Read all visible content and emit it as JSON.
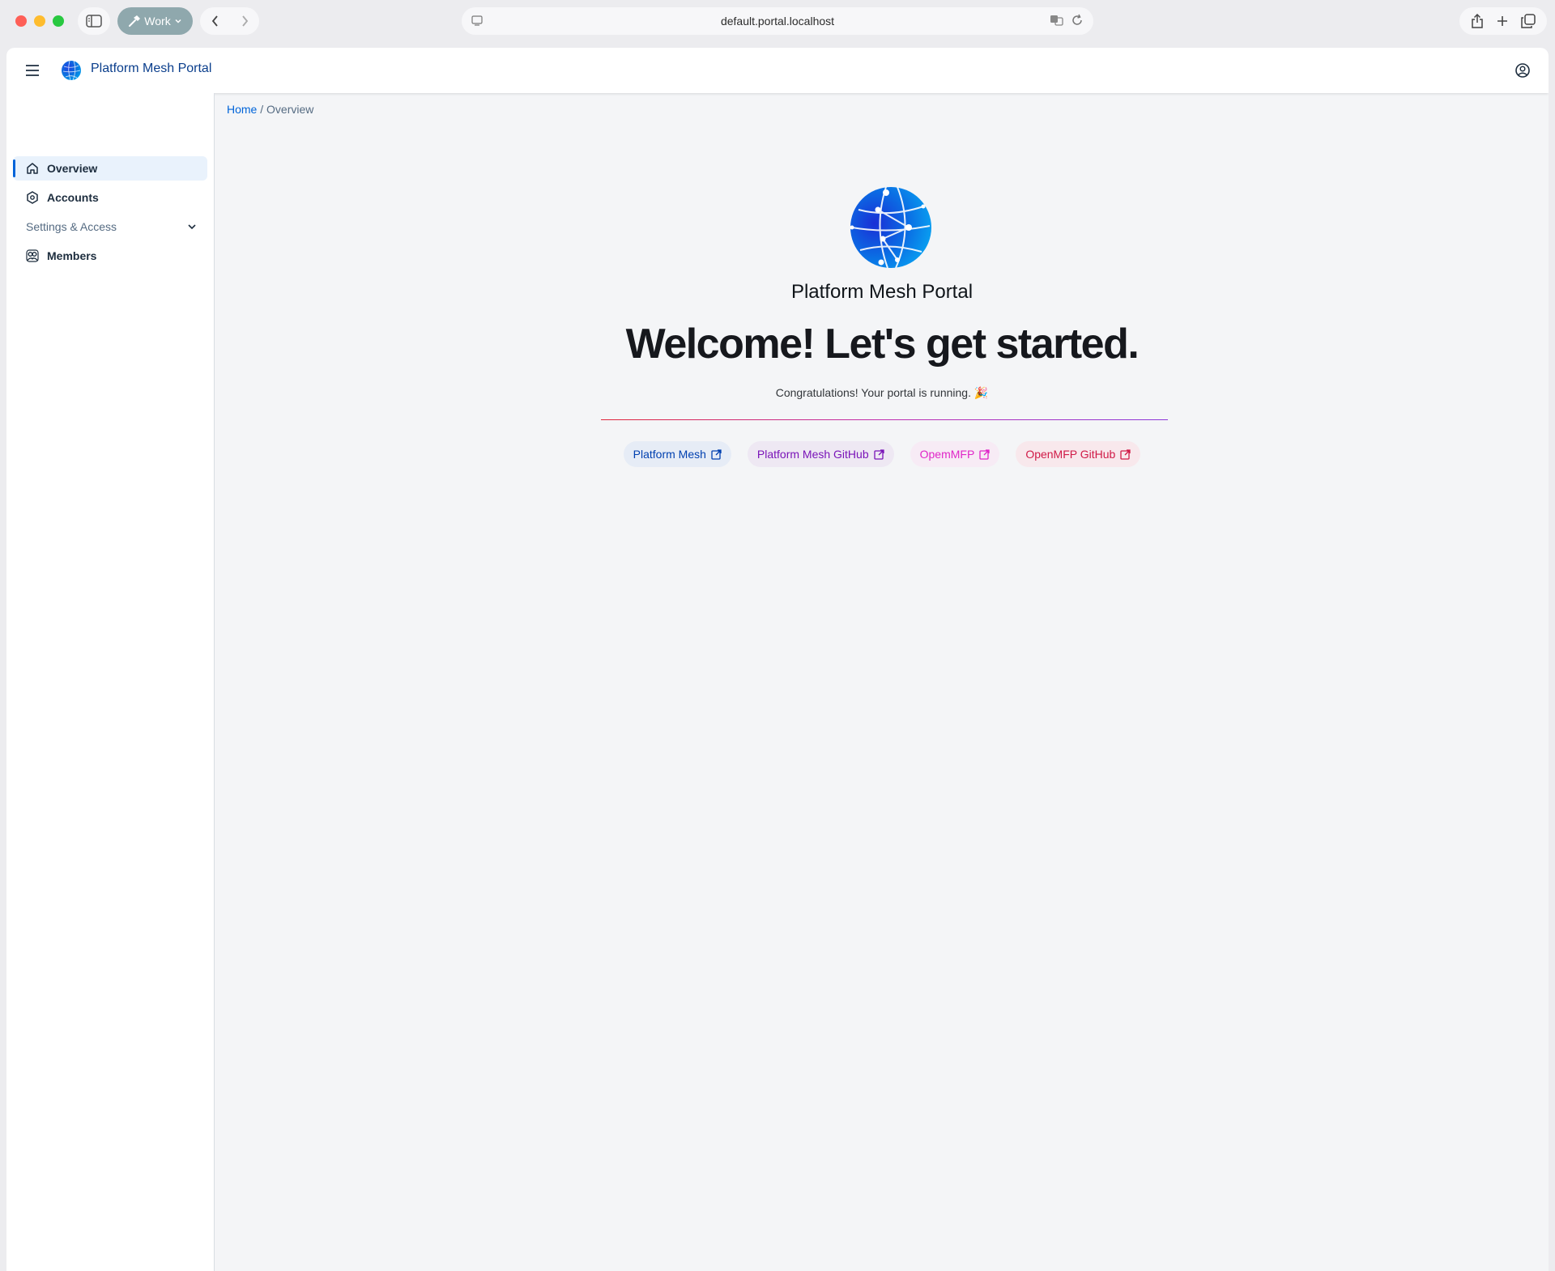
{
  "browser": {
    "profile_label": "Work",
    "url": "default.portal.localhost"
  },
  "shellbar": {
    "title": "Platform Mesh Portal"
  },
  "sidenav": {
    "items": [
      {
        "label": "Overview"
      },
      {
        "label": "Accounts"
      },
      {
        "label": "Settings & Access"
      },
      {
        "label": "Members"
      }
    ]
  },
  "breadcrumb": {
    "home": "Home",
    "separator": "/",
    "current": "Overview"
  },
  "main": {
    "product_title": "Platform Mesh Portal",
    "welcome": "Welcome! Let's get started.",
    "congrats": "Congratulations! Your portal is running. 🎉",
    "links": [
      {
        "label": "Platform Mesh",
        "color": "#0040b0"
      },
      {
        "label": "Platform Mesh GitHub",
        "color": "#7a14b8"
      },
      {
        "label": "OpemMFP",
        "color": "#e026c8"
      },
      {
        "label": "OpenMFP GitHub",
        "color": "#d01a47"
      }
    ]
  },
  "colors": {
    "accent": "#0064d9",
    "brand_title": "#0a3e8c"
  }
}
